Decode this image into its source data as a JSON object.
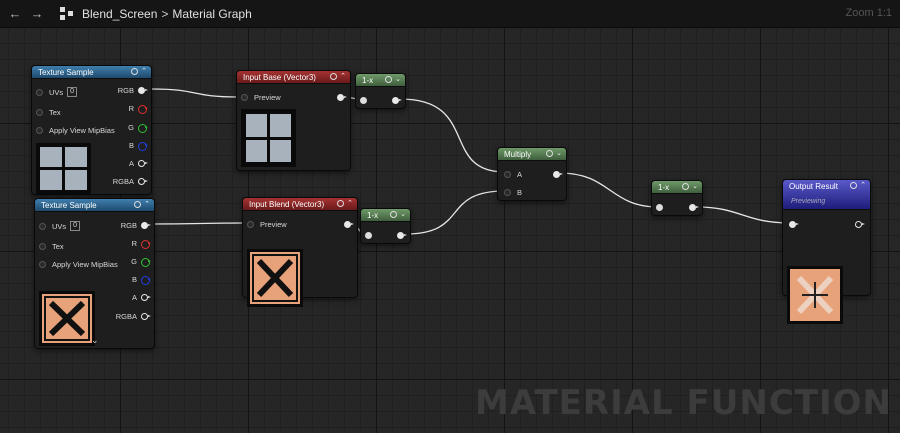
{
  "toolbar": {
    "back_icon": "arrow-left-icon",
    "forward_icon": "arrow-right-icon",
    "graph_icon": "graph-icon",
    "breadcrumb": [
      "Blend_Screen",
      "Material Graph"
    ],
    "separator": ">",
    "zoom": "Zoom 1:1"
  },
  "watermark": "MATERIAL FUNCTION",
  "nodes": {
    "texture_sample_1": {
      "title": "Texture Sample",
      "inputs": [
        "UVs",
        "Tex",
        "Apply View MipBias"
      ],
      "uv_value": "0",
      "outputs": [
        "RGB",
        "R",
        "G",
        "B",
        "A",
        "RGBA"
      ],
      "preview": "gray-four-squares"
    },
    "texture_sample_2": {
      "title": "Texture Sample",
      "inputs": [
        "UVs",
        "Tex",
        "Apply View MipBias"
      ],
      "uv_value": "0",
      "outputs": [
        "RGB",
        "R",
        "G",
        "B",
        "A",
        "RGBA"
      ],
      "preview": "orange-x-pattern",
      "expand_icon": "chevron-down-icon"
    },
    "input_base": {
      "title": "Input Base (Vector3)",
      "preview_label": "Preview"
    },
    "input_blend": {
      "title": "Input Blend (Vector3)",
      "preview_label": "Preview"
    },
    "one_minus_1": {
      "title": "1-x"
    },
    "one_minus_2": {
      "title": "1-x"
    },
    "one_minus_3": {
      "title": "1-x"
    },
    "multiply": {
      "title": "Multiply",
      "inputs": [
        "A",
        "B"
      ]
    },
    "output_result": {
      "title": "Output Result",
      "status": "Previewing"
    }
  },
  "colors": {
    "texture_header": "#2f6a97",
    "input_header": "#8e2a2a",
    "math_header": "#5d8a59",
    "output_header": "#3b3aa8",
    "x_pattern_bg": "#e8a27a"
  }
}
